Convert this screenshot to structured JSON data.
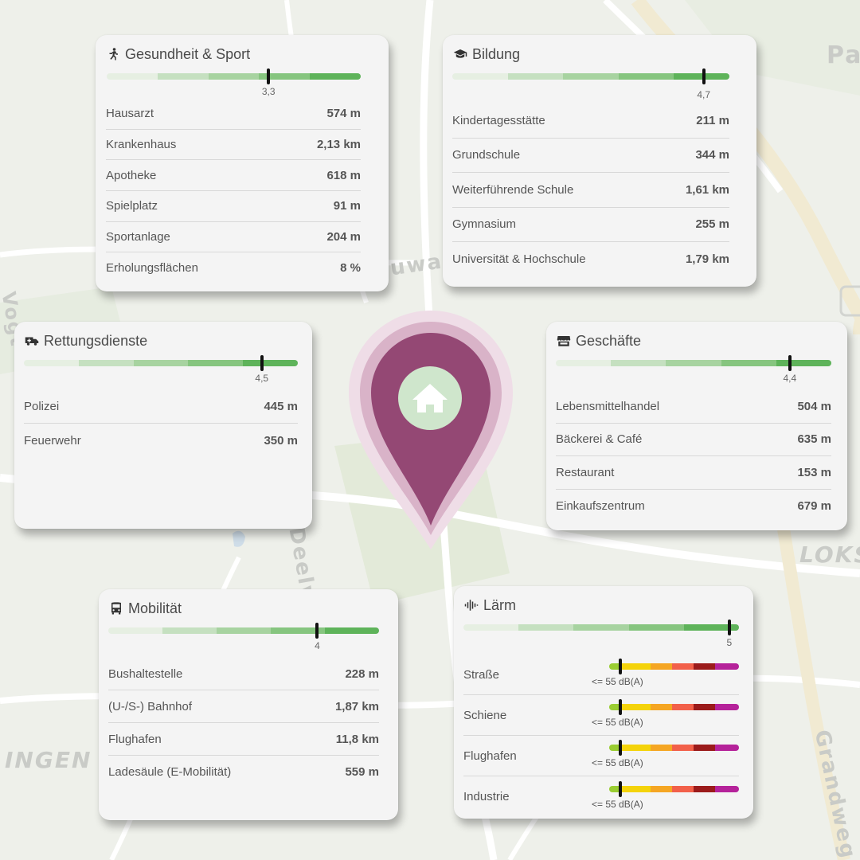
{
  "map": {
    "labels": [
      "Pa",
      "uwa",
      "Deelwisch",
      "LOKS",
      "INGEN",
      "Grandweg",
      "Vogt"
    ]
  },
  "colors": {
    "pin": "#944874",
    "pin_halo": "#d9b3c8",
    "home_circle": "#cfe6cc",
    "noise_scale": [
      "#9acd32",
      "#f4d30a",
      "#f5a623",
      "#f2604a",
      "#9b1b1b",
      "#b5229a"
    ]
  },
  "cards": {
    "health": {
      "title": "Gesundheit & Sport",
      "icon": "running-icon",
      "score": 3.3,
      "score_label": "3,3",
      "rows": [
        {
          "label": "Hausarzt",
          "value": "574 m"
        },
        {
          "label": "Krankenhaus",
          "value": "2,13 km"
        },
        {
          "label": "Apotheke",
          "value": "618 m"
        },
        {
          "label": "Spielplatz",
          "value": "91 m"
        },
        {
          "label": "Sportanlage",
          "value": "204 m"
        },
        {
          "label": "Erholungsflächen",
          "value": "8 %"
        }
      ]
    },
    "education": {
      "title": "Bildung",
      "icon": "graduation-cap-icon",
      "score": 4.7,
      "score_label": "4,7",
      "rows": [
        {
          "label": "Kindertagesstätte",
          "value": "211 m"
        },
        {
          "label": "Grundschule",
          "value": "344 m"
        },
        {
          "label": "Weiterführende Schule",
          "value": "1,61 km"
        },
        {
          "label": "Gymnasium",
          "value": "255 m"
        },
        {
          "label": "Universität & Hochschule",
          "value": "1,79 km"
        }
      ]
    },
    "rescue": {
      "title": "Rettungsdienste",
      "icon": "ambulance-icon",
      "score": 4.5,
      "score_label": "4,5",
      "rows": [
        {
          "label": "Polizei",
          "value": "445 m"
        },
        {
          "label": "Feuerwehr",
          "value": "350 m"
        }
      ]
    },
    "shops": {
      "title": "Geschäfte",
      "icon": "store-icon",
      "score": 4.4,
      "score_label": "4,4",
      "rows": [
        {
          "label": "Lebensmittelhandel",
          "value": "504 m"
        },
        {
          "label": "Bäckerei & Café",
          "value": "635 m"
        },
        {
          "label": "Restaurant",
          "value": "153 m"
        },
        {
          "label": "Einkaufszentrum",
          "value": "679 m"
        }
      ]
    },
    "mobility": {
      "title": "Mobilität",
      "icon": "bus-icon",
      "score": 4,
      "score_label": "4",
      "rows": [
        {
          "label": "Bushaltestelle",
          "value": "228 m"
        },
        {
          "label": "(U-/S-) Bahnhof",
          "value": "1,87 km"
        },
        {
          "label": "Flughafen",
          "value": "11,8 km"
        },
        {
          "label": "Ladesäule (E-Mobilität)",
          "value": "559 m"
        }
      ]
    },
    "noise": {
      "title": "Lärm",
      "icon": "sound-wave-icon",
      "score": 5,
      "score_label": "5",
      "rows": [
        {
          "label": "Straße",
          "level": "<= 55 dB(A)"
        },
        {
          "label": "Schiene",
          "level": "<= 55 dB(A)"
        },
        {
          "label": "Flughafen",
          "level": "<= 55 dB(A)"
        },
        {
          "label": "Industrie",
          "level": "<= 55 dB(A)"
        }
      ]
    }
  }
}
